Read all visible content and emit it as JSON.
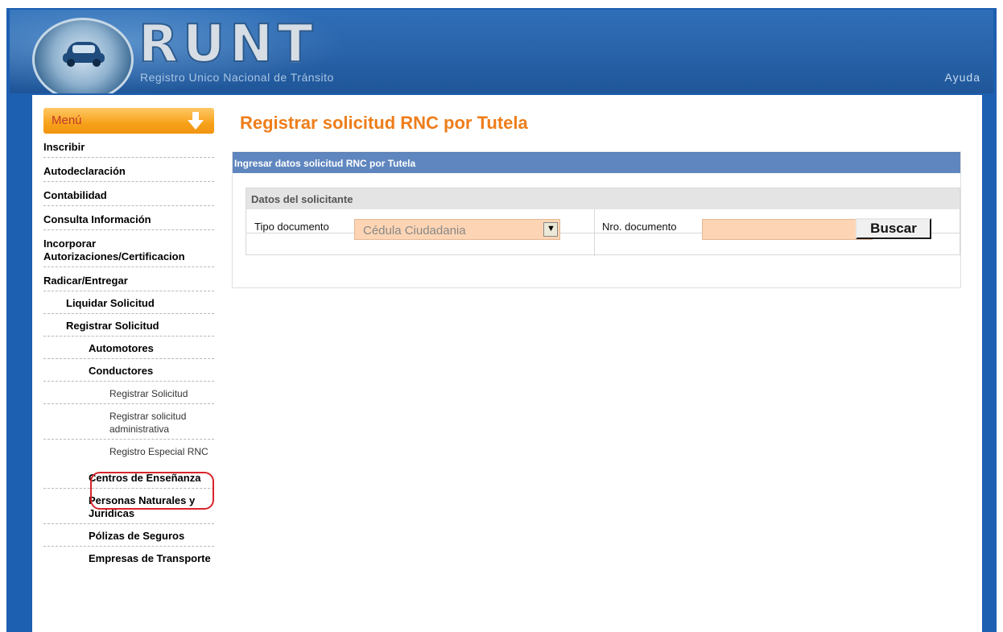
{
  "header": {
    "brand": "RUNT",
    "subtitle": "Registro Unico Nacional de Tránsito",
    "help_link": "Ayuda"
  },
  "sidebar": {
    "menu_title": "Menú",
    "items": [
      {
        "label": "Inscribir",
        "level": 0
      },
      {
        "label": "Autodeclaración",
        "level": 0
      },
      {
        "label": "Contabilidad",
        "level": 0
      },
      {
        "label": "Consulta Información",
        "level": 0
      },
      {
        "label": "Incorporar Autorizaciones/Certificacion",
        "level": 0
      },
      {
        "label": "Radicar/Entregar",
        "level": 0
      },
      {
        "label": "Liquidar Solicitud",
        "level": 1
      },
      {
        "label": "Registrar Solicitud",
        "level": 1
      },
      {
        "label": "Automotores",
        "level": 2
      },
      {
        "label": "Conductores",
        "level": 2
      },
      {
        "label": "Registrar Solicitud",
        "level": 3
      },
      {
        "label": "Registrar solicitud administrativa",
        "level": 3
      },
      {
        "label": "Registro Especial RNC",
        "level": 3,
        "highlighted": true
      },
      {
        "label": "Centros de Enseñanza",
        "level": 2
      },
      {
        "label": "Personas Naturales y Juridicas",
        "level": 2
      },
      {
        "label": "Pólizas de Seguros",
        "level": 2
      },
      {
        "label": "Empresas de Transporte",
        "level": 2
      }
    ]
  },
  "main": {
    "page_title": "Registrar solicitud RNC por Tutela",
    "panel_header": "Ingresar datos solicitud RNC por Tutela",
    "section_title": "Datos del solicitante",
    "tipo_documento_label": "Tipo documento",
    "tipo_documento_value": "Cédula Ciudadania",
    "nro_documento_label": "Nro. documento",
    "nro_documento_value": "",
    "buscar_label": "Buscar"
  },
  "colors": {
    "accent_orange": "#ee7d1a",
    "header_blue": "#2a64ab",
    "panel_header_blue": "#5f86bf",
    "input_fill": "#fdd5b4",
    "highlight_red": "#d9242b"
  }
}
